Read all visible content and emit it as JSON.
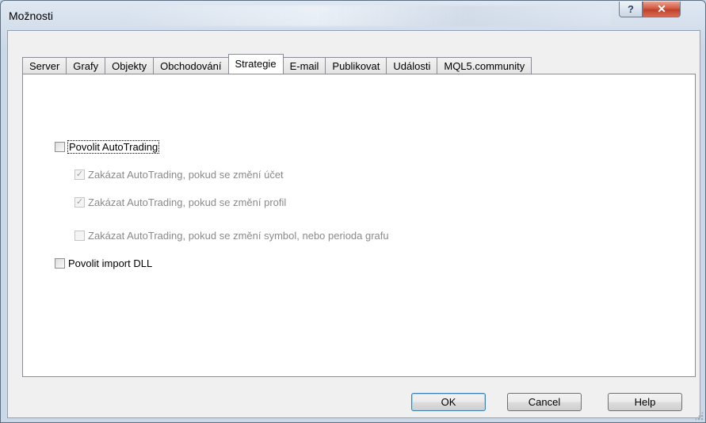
{
  "window": {
    "title": "Možnosti",
    "help_glyph": "?",
    "close_glyph": "✕"
  },
  "tabs": [
    {
      "label": "Server",
      "active": false
    },
    {
      "label": "Grafy",
      "active": false
    },
    {
      "label": "Objekty",
      "active": false
    },
    {
      "label": "Obchodování",
      "active": false
    },
    {
      "label": "Strategie",
      "active": true
    },
    {
      "label": "E-mail",
      "active": false
    },
    {
      "label": "Publikovat",
      "active": false
    },
    {
      "label": "Události",
      "active": false
    },
    {
      "label": "MQL5.community",
      "active": false
    }
  ],
  "options": {
    "allow_autotrading": {
      "label": "Povolit AutoTrading",
      "checked": false,
      "enabled": true
    },
    "disable_on_account_change": {
      "label": "Zakázat AutoTrading, pokud se změní účet",
      "checked": true,
      "enabled": false
    },
    "disable_on_profile_change": {
      "label": "Zakázat AutoTrading, pokud se změní profil",
      "checked": true,
      "enabled": false
    },
    "disable_on_symbol_change": {
      "label": "Zakázat AutoTrading, pokud se změní symbol, nebo perioda grafu",
      "checked": false,
      "enabled": false
    },
    "allow_dll_import": {
      "label": "Povolit import DLL",
      "checked": false,
      "enabled": true
    }
  },
  "buttons": {
    "ok": "OK",
    "cancel": "Cancel",
    "help": "Help"
  },
  "check_glyph": "✓"
}
